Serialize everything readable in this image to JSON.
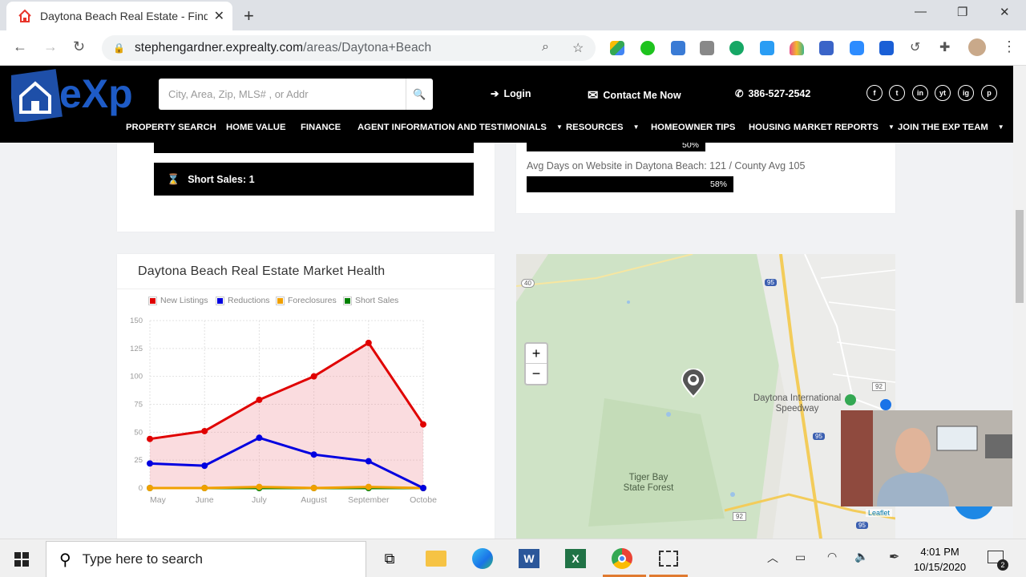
{
  "browser": {
    "tab_title": "Daytona Beach Real Estate - Find",
    "url_domain": "stephengardner.exprealty.com",
    "url_path": "/areas/Daytona+Beach"
  },
  "header": {
    "logo_text": "eXp",
    "search_placeholder": "City, Area, Zip, MLS# , or Addr",
    "login": "Login",
    "contact": "Contact Me Now",
    "phone": "386-527-2542",
    "social": [
      "f",
      "t",
      "in",
      "yt",
      "ig",
      "p"
    ]
  },
  "menu": [
    {
      "label": "PROPERTY SEARCH",
      "caret": false
    },
    {
      "label": "HOME VALUE",
      "caret": false
    },
    {
      "label": "FINANCE",
      "caret": false
    },
    {
      "label": "AGENT INFORMATION AND TESTIMONIALS",
      "caret": true
    },
    {
      "label": "RESOURCES",
      "caret": true
    },
    {
      "label": "HOMEOWNER TIPS",
      "caret": false
    },
    {
      "label": "HOUSING MARKET REPORTS",
      "caret": true
    },
    {
      "label": "JOIN THE EXP TEAM",
      "caret": true
    }
  ],
  "stats": {
    "short_sales": "Short Sales: 1",
    "prev_bar_pct": "50%",
    "avg_days_text": "Avg Days on Website in Daytona Beach: 121 / County Avg 105",
    "avg_days_pct": "58%",
    "avg_days_fraction": 0.58
  },
  "chart_data": {
    "type": "line",
    "title": "Daytona Beach Real Estate Market Health",
    "categories": [
      "May",
      "June",
      "July",
      "August",
      "September",
      "Octobe"
    ],
    "ylim": [
      0,
      150
    ],
    "yticks": [
      0,
      25,
      50,
      75,
      100,
      125,
      150
    ],
    "series": [
      {
        "name": "New Listings",
        "color": "#e00000",
        "values": [
          44,
          51,
          79,
          100,
          130,
          57
        ],
        "fill": "rgba(240,140,150,0.3)"
      },
      {
        "name": "Reductions",
        "color": "#0000e0",
        "values": [
          22,
          20,
          45,
          30,
          24,
          0
        ]
      },
      {
        "name": "Foreclosures",
        "color": "#f0a000",
        "values": [
          0,
          0,
          1,
          0,
          1,
          0
        ]
      },
      {
        "name": "Short Sales",
        "color": "#008000",
        "values": [
          0,
          0,
          0,
          0,
          0,
          0
        ]
      }
    ],
    "grid": true,
    "legend": "top"
  },
  "map": {
    "labels": [
      "Daytona International Speedway",
      "Tiger Bay State Forest"
    ],
    "road_shields": [
      "40",
      "95",
      "92",
      "95",
      "92",
      "95"
    ],
    "attribution": "Leaflet",
    "zoom_in": "+",
    "zoom_out": "−"
  },
  "taskbar": {
    "search_text": "Type here to search",
    "time": "4:01 PM",
    "date": "10/15/2020",
    "notifications": "2"
  }
}
